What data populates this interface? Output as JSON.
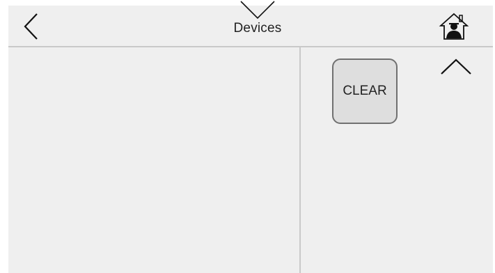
{
  "header": {
    "title": "Devices",
    "back_icon": "chevron-left-icon",
    "pull_down_icon": "chevron-down-icon",
    "home_icon": "home-user-icon"
  },
  "side_panel": {
    "clear_label": "CLEAR",
    "scroll_icon": "chevron-up-icon"
  },
  "colors": {
    "background": "#efefef",
    "divider": "#c9c9c9",
    "button_fill": "#dedede",
    "button_border": "#707070",
    "text": "#222222"
  }
}
